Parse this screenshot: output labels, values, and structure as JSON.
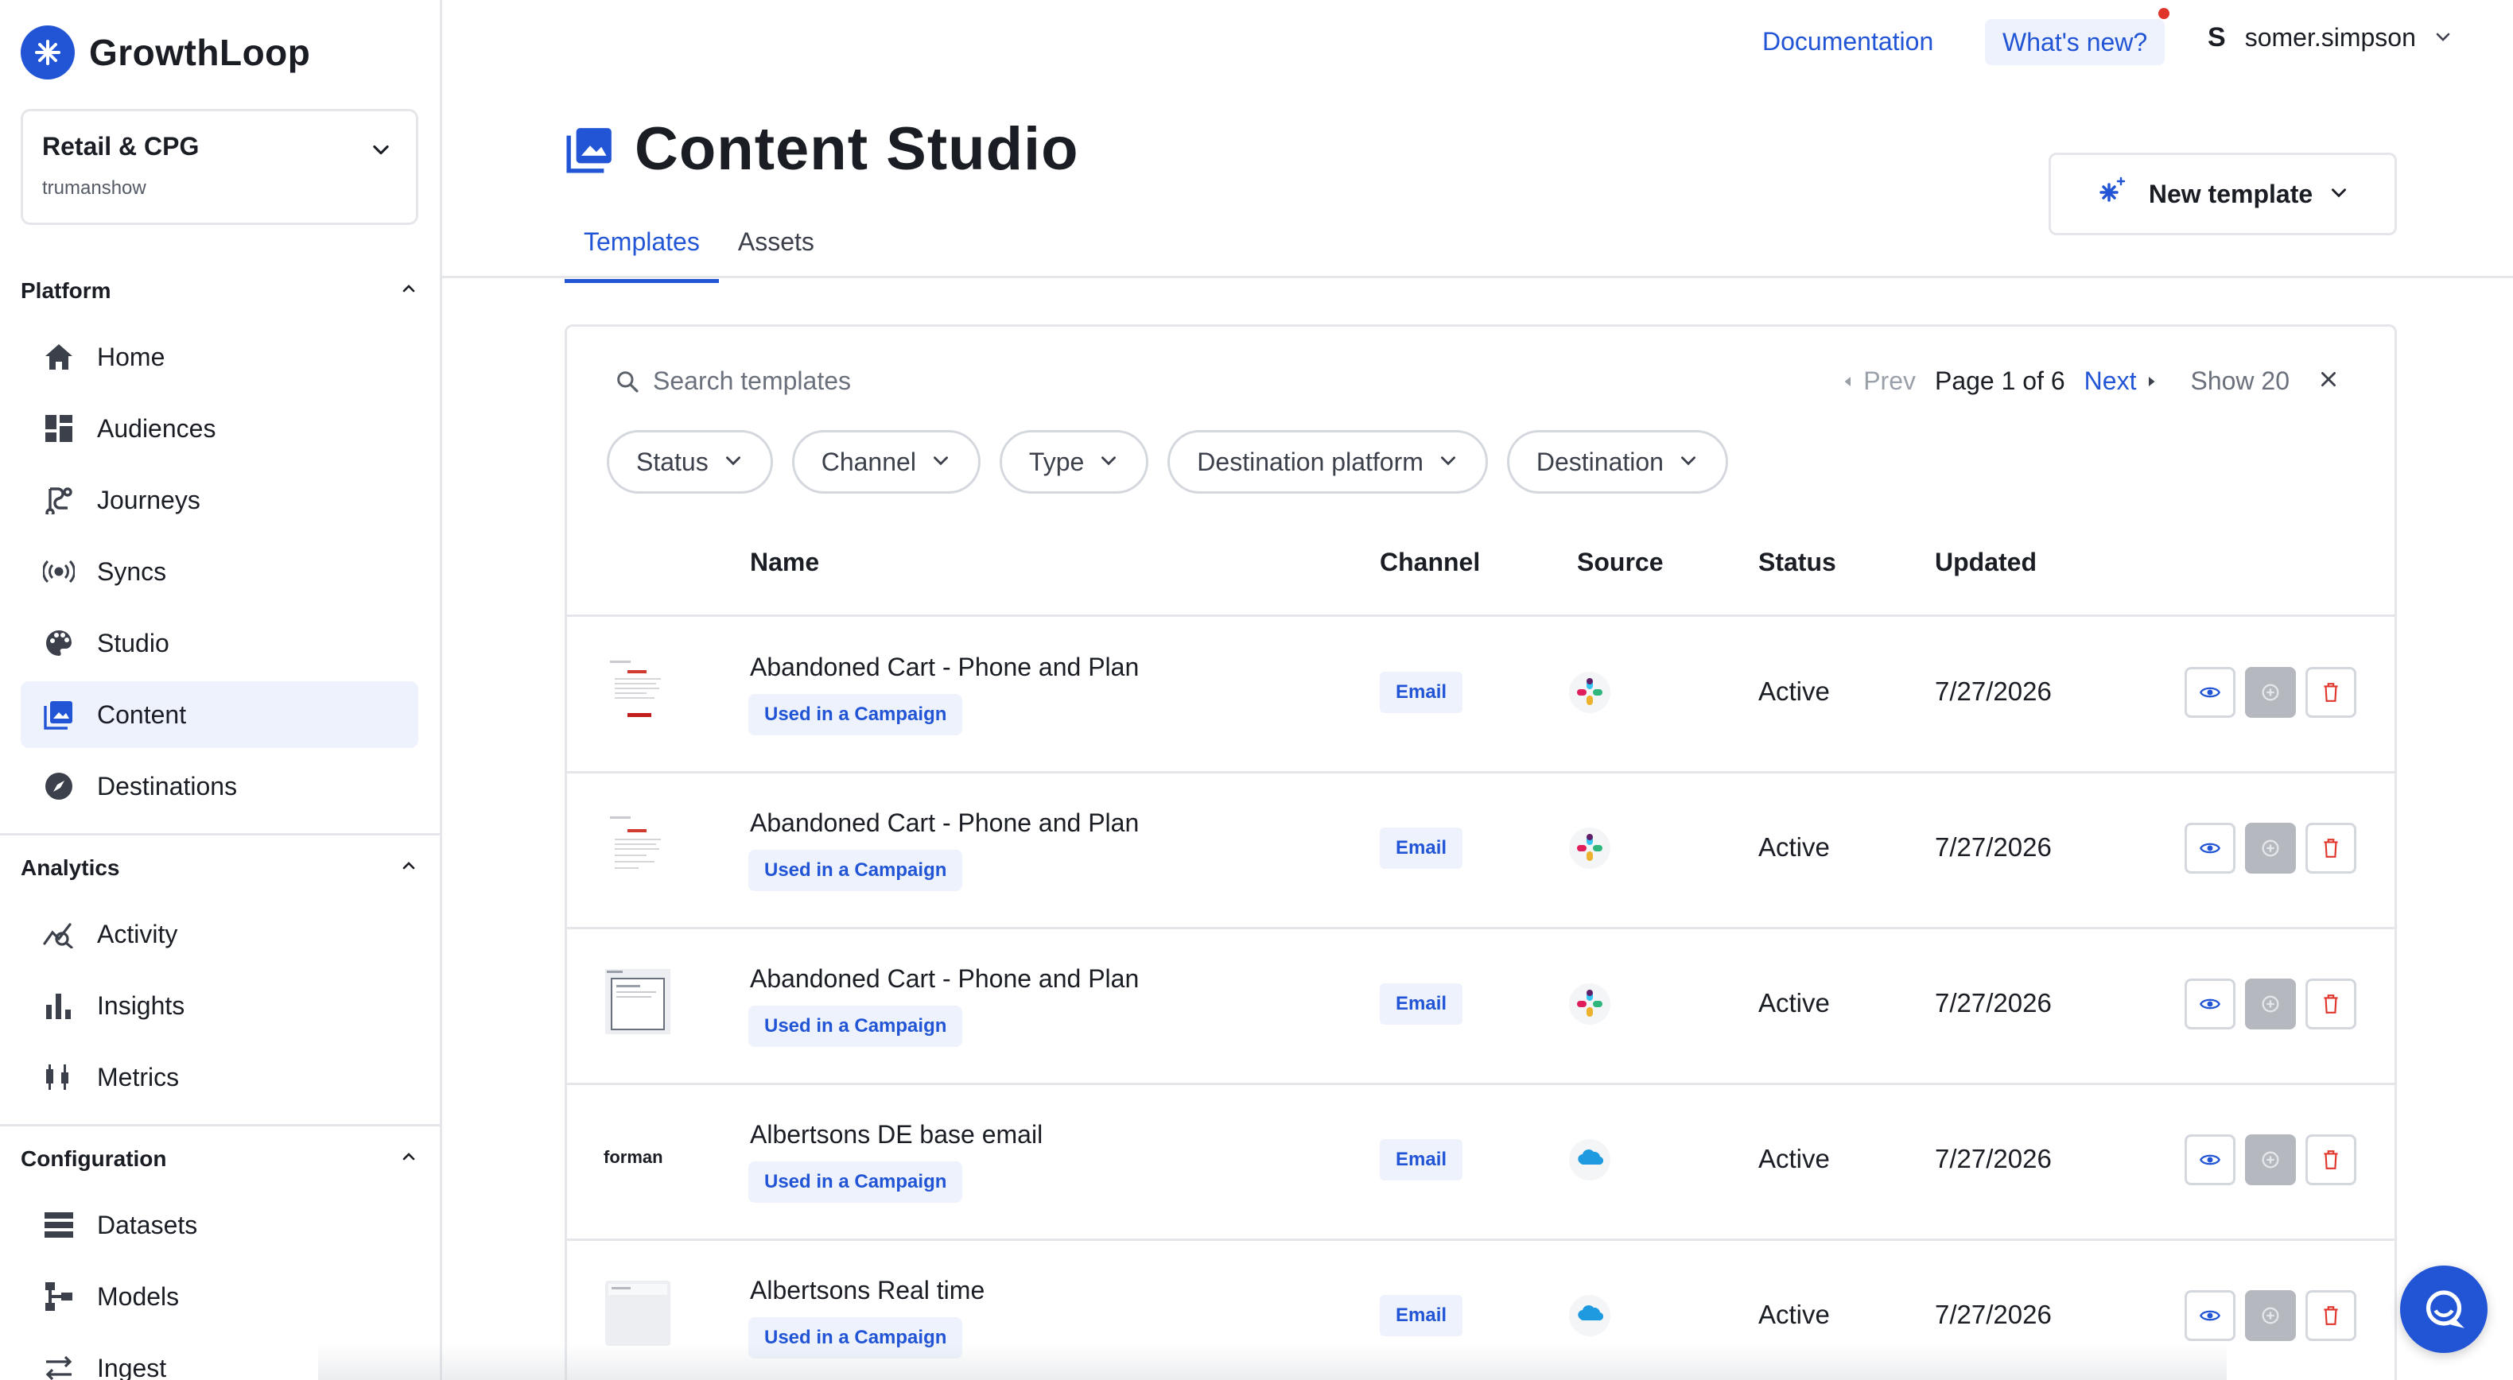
{
  "brand": {
    "name": "GrowthLoop"
  },
  "workspace": {
    "name": "Retail & CPG",
    "sub": "trumanshow"
  },
  "sidebar": {
    "sections": [
      {
        "title": "Platform",
        "items": [
          "Home",
          "Audiences",
          "Journeys",
          "Syncs",
          "Studio",
          "Content",
          "Destinations"
        ]
      },
      {
        "title": "Analytics",
        "items": [
          "Activity",
          "Insights",
          "Metrics"
        ]
      },
      {
        "title": "Configuration",
        "items": [
          "Datasets",
          "Models",
          "Ingest"
        ]
      }
    ],
    "active_item": "Content"
  },
  "topbar": {
    "docs": "Documentation",
    "whats_new": "What's new?",
    "user_initial": "S",
    "user_name": "somer.simpson"
  },
  "page": {
    "title": "Content Studio",
    "tabs": [
      "Templates",
      "Assets"
    ],
    "active_tab": "Templates",
    "new_template": "New template"
  },
  "toolbar": {
    "search_placeholder": "Search templates",
    "prev": "Prev",
    "page_info": "Page 1 of 6",
    "next": "Next",
    "show": "Show 20"
  },
  "filters": [
    "Status",
    "Channel",
    "Type",
    "Destination platform",
    "Destination"
  ],
  "table": {
    "columns": [
      "Name",
      "Channel",
      "Source",
      "Status",
      "Updated"
    ],
    "rows": [
      {
        "name": "Abandoned Cart - Phone and Plan",
        "badge": "Used in a Campaign",
        "channel": "Email",
        "source": "slack-icon",
        "status": "Active",
        "updated": "7/27/2026",
        "thumb_text": ""
      },
      {
        "name": "Abandoned Cart - Phone and Plan",
        "badge": "Used in a Campaign",
        "channel": "Email",
        "source": "slack-icon",
        "status": "Active",
        "updated": "7/27/2026",
        "thumb_text": ""
      },
      {
        "name": "Abandoned Cart - Phone and Plan",
        "badge": "Used in a Campaign",
        "channel": "Email",
        "source": "slack-icon",
        "status": "Active",
        "updated": "7/27/2026",
        "thumb_text": ""
      },
      {
        "name": "Albertsons DE base email",
        "badge": "Used in a Campaign",
        "channel": "Email",
        "source": "salesforce-icon",
        "status": "Active",
        "updated": "7/27/2026",
        "thumb_text": "forman"
      },
      {
        "name": "Albertsons Real time",
        "badge": "Used in a Campaign",
        "channel": "Email",
        "source": "salesforce-icon",
        "status": "Active",
        "updated": "7/27/2026",
        "thumb_text": ""
      }
    ]
  },
  "colors": {
    "accent": "#2155d5",
    "danger": "#e0352b",
    "border": "#e4e6ea"
  }
}
